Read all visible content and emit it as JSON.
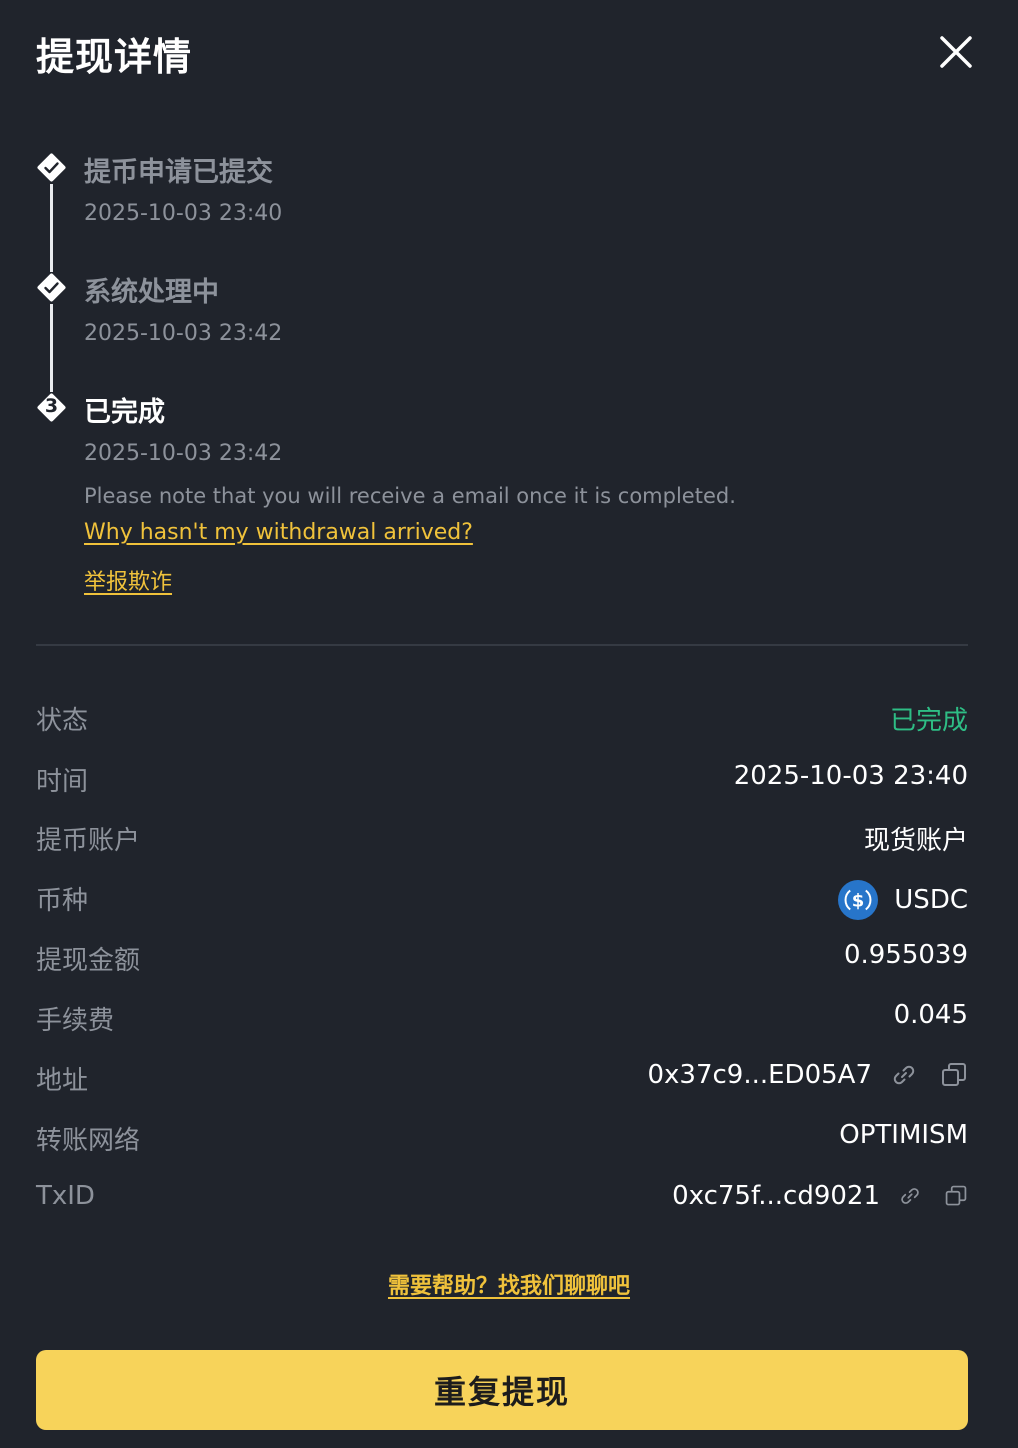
{
  "header": {
    "title": "提现详情"
  },
  "timeline": [
    {
      "title": "提币申请已提交",
      "time": "2025-10-03 23:40",
      "state": "done"
    },
    {
      "title": "系统处理中",
      "time": "2025-10-03 23:42",
      "state": "done"
    },
    {
      "title": "已完成",
      "time": "2025-10-03 23:42",
      "state": "active",
      "step_number": "3"
    }
  ],
  "note": "Please note that you will receive a email once it is completed.",
  "links": {
    "why_not_arrived": "Why hasn't my withdrawal arrived?",
    "report_fraud": "举报欺诈"
  },
  "details": {
    "status": {
      "label": "状态",
      "value": "已完成"
    },
    "time": {
      "label": "时间",
      "value": "2025-10-03 23:40"
    },
    "account": {
      "label": "提币账户",
      "value": "现货账户"
    },
    "coin": {
      "label": "币种",
      "value": "USDC",
      "icon": "usdc-coin-icon"
    },
    "amount": {
      "label": "提现金额",
      "value": "0.955039"
    },
    "fee": {
      "label": "手续费",
      "value": "0.045"
    },
    "address": {
      "label": "地址",
      "value": "0x37c9...ED05A7"
    },
    "network": {
      "label": "转账网络",
      "value": "OPTIMISM"
    },
    "txid": {
      "label": "TxID",
      "value": "0xc75f...cd9021"
    }
  },
  "help_link": "需要帮助？找我们聊聊吧",
  "primary_button": "重复提现",
  "colors": {
    "accent": "#f0c23b",
    "button": "#f7d35a",
    "success": "#2ebd85",
    "background": "#20242c",
    "muted": "#8d929b"
  }
}
